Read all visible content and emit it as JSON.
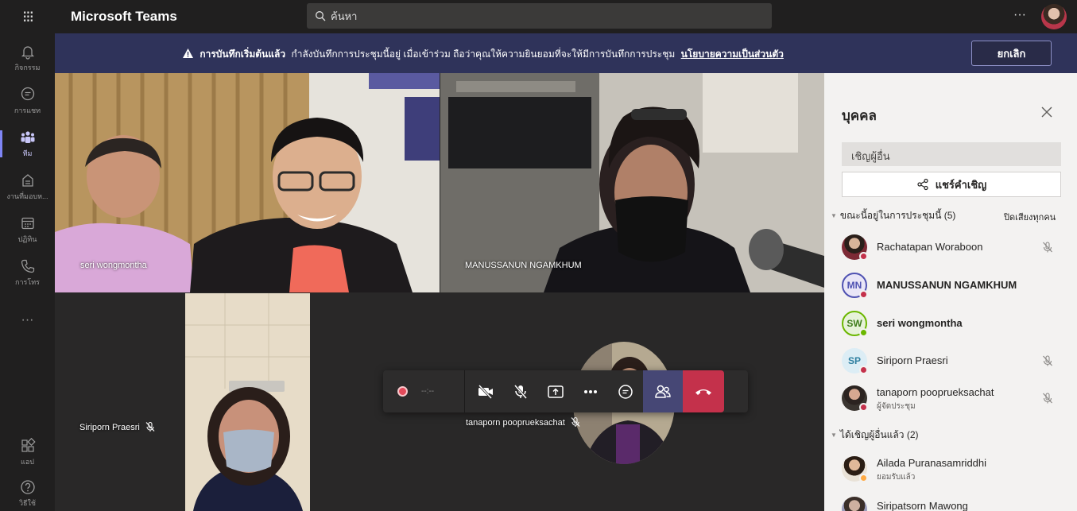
{
  "app": {
    "name": "Microsoft Teams",
    "search_placeholder": "ค้นหา",
    "more": "···"
  },
  "rail": {
    "items": [
      {
        "label": "กิจกรรม",
        "icon": "bell-icon"
      },
      {
        "label": "การแชท",
        "icon": "chat-icon"
      },
      {
        "label": "ทีม",
        "icon": "teams-icon"
      },
      {
        "label": "งานที่มอบห...",
        "icon": "assignments-icon"
      },
      {
        "label": "ปฏิทิน",
        "icon": "calendar-icon"
      },
      {
        "label": "การโทร",
        "icon": "phone-icon"
      },
      {
        "label": "แอป",
        "icon": "apps-icon"
      },
      {
        "label": "วิธีใช้",
        "icon": "help-icon"
      }
    ],
    "more": "···"
  },
  "banner": {
    "title": "การบันทึกเริ่มต้นแล้ว",
    "message": "กำลังบันทึกการประชุมนี้อยู่ เมื่อเข้าร่วม ถือว่าคุณให้ความยินยอมที่จะให้มีการบันทึกการประชุม",
    "link": "นโยบายความเป็นส่วนตัว",
    "cancel": "ยกเลิก"
  },
  "tiles": [
    {
      "name": "seri wongmontha"
    },
    {
      "name": "MANUSSANUN NGAMKHUM"
    },
    {
      "name": "Siriporn Praesri",
      "muted": true
    },
    {
      "name": "tanaporn pooprueksachat",
      "muted": true
    }
  ],
  "controls": {
    "timer": "--:--"
  },
  "panel": {
    "title": "บุคคล",
    "invite_placeholder": "เชิญผู้อื่น",
    "share_invite": "แชร์คำเชิญ",
    "in_meeting_label": "ขณะนี้อยู่ในการประชุมนี้ (5)",
    "mute_all": "ปิดเสียงทุกคน",
    "participants": [
      {
        "name": "Rachatapan Woraboon",
        "initials": "",
        "bold": false,
        "muted": true,
        "status": "#c4314b"
      },
      {
        "name": "MANUSSANUN NGAMKHUM",
        "initials": "MN",
        "bold": true,
        "muted": false,
        "status": "#c4314b"
      },
      {
        "name": "seri wongmontha",
        "initials": "SW",
        "bold": true,
        "muted": false,
        "status": "#6bb700"
      },
      {
        "name": "Siriporn Praesri",
        "initials": "SP",
        "bold": false,
        "muted": true,
        "status": "#c4314b"
      },
      {
        "name": "tanaporn pooprueksachat",
        "subtitle": "ผู้จัดประชุม",
        "initials": "",
        "bold": false,
        "muted": true,
        "status": "#c4314b"
      }
    ],
    "invited_label": "ได้เชิญผู้อื่นแล้ว (2)",
    "invited": [
      {
        "name": "Ailada Puranasamriddhi",
        "subtitle": "ยอมรับแล้ว",
        "status": "#ffaa44"
      },
      {
        "name": "Siripatsorn Mawong"
      }
    ]
  },
  "colors": {
    "banner_bg": "#2f335a",
    "accent": "#7f85f5",
    "hangup": "#c4314b",
    "people_active": "#464775"
  }
}
